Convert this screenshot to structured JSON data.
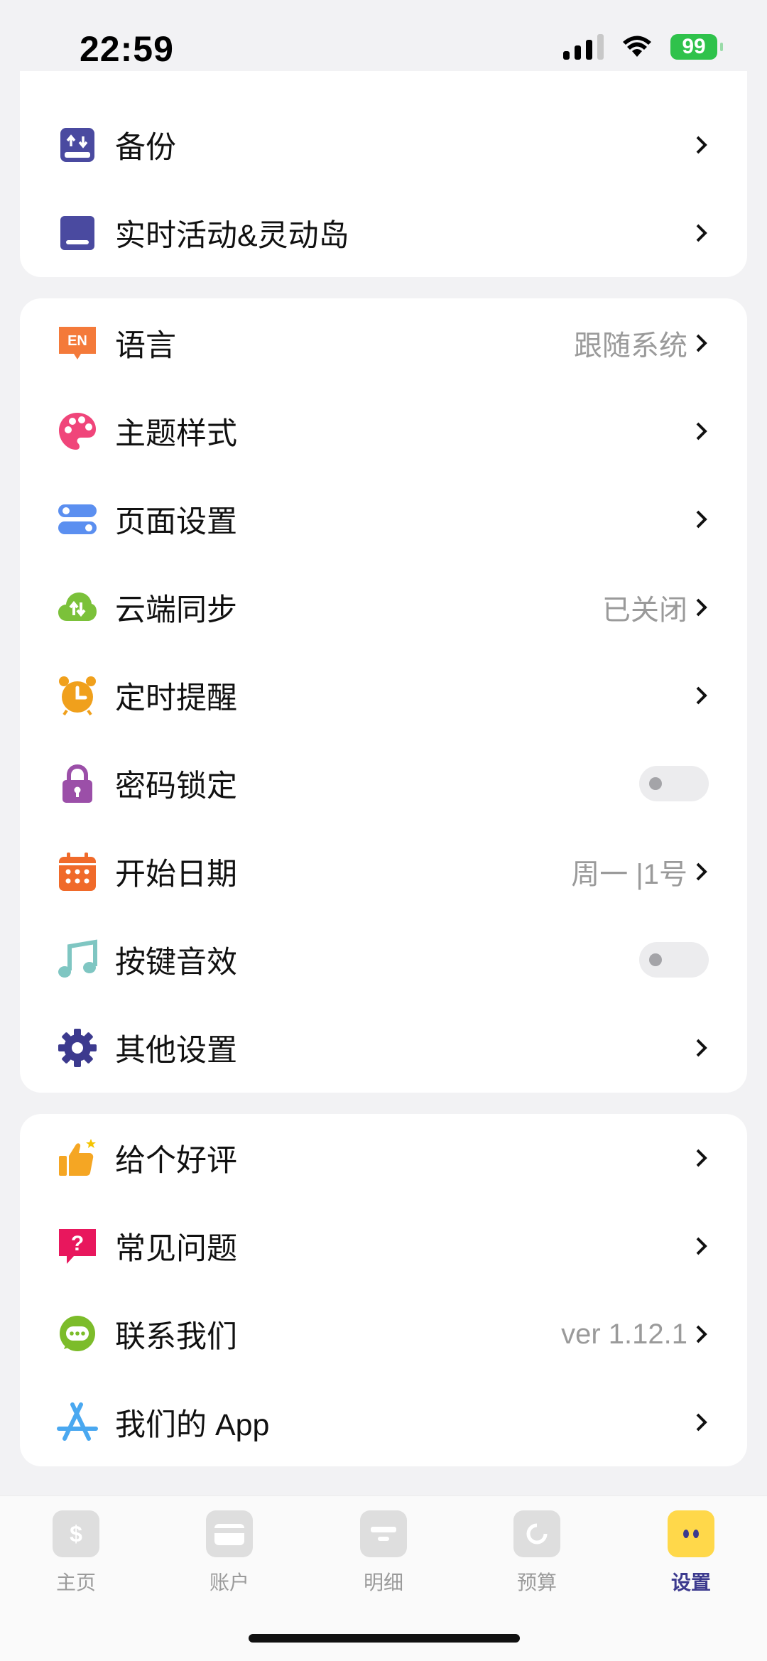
{
  "status": {
    "time": "22:59",
    "battery": "99"
  },
  "group1": [
    {
      "label": "备份",
      "icon": "backup-icon"
    },
    {
      "label": "实时活动&灵动岛",
      "icon": "live-activity-icon"
    }
  ],
  "group2": [
    {
      "label": "语言",
      "value": "跟随系统",
      "icon": "language-icon",
      "icon_text": "EN"
    },
    {
      "label": "主题样式",
      "icon": "palette-icon"
    },
    {
      "label": "页面设置",
      "icon": "page-settings-icon"
    },
    {
      "label": "云端同步",
      "value": "已关闭",
      "icon": "cloud-sync-icon"
    },
    {
      "label": "定时提醒",
      "icon": "alarm-clock-icon"
    },
    {
      "label": "密码锁定",
      "icon": "lock-icon",
      "toggle": false
    },
    {
      "label": "开始日期",
      "value": "周一 |1号",
      "icon": "calendar-icon"
    },
    {
      "label": "按键音效",
      "icon": "music-note-icon",
      "toggle": false
    },
    {
      "label": "其他设置",
      "icon": "gear-icon"
    }
  ],
  "group3": [
    {
      "label": "给个好评",
      "icon": "thumbs-up-icon"
    },
    {
      "label": "常见问题",
      "icon": "question-icon"
    },
    {
      "label": "联系我们",
      "value": "ver 1.12.1",
      "icon": "chat-icon"
    },
    {
      "label": "我们的 App",
      "icon": "app-store-icon"
    }
  ],
  "tabs": [
    {
      "label": "主页",
      "icon": "home-dollar-icon"
    },
    {
      "label": "账户",
      "icon": "wallet-icon"
    },
    {
      "label": "明细",
      "icon": "details-icon"
    },
    {
      "label": "预算",
      "icon": "budget-icon"
    },
    {
      "label": "设置",
      "icon": "settings-face-icon",
      "active": true
    }
  ],
  "colors": {
    "accent": "#3c3a8e",
    "active_tab": "#ffd84a",
    "toggle_off": "#ececee",
    "value_gray": "#9a9a9a"
  }
}
